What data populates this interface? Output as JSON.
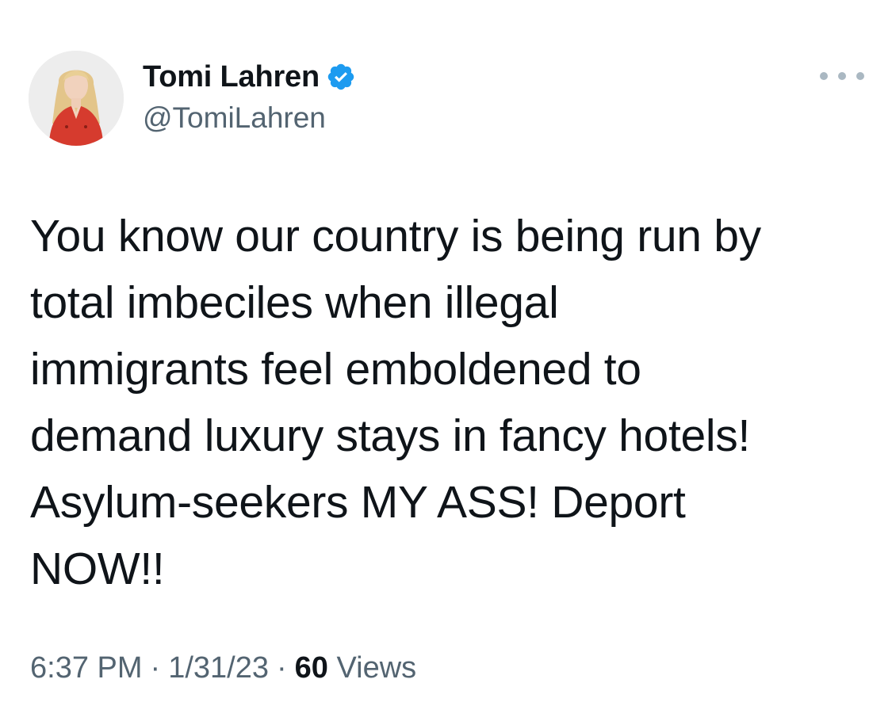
{
  "author": {
    "display_name": "Tomi Lahren",
    "handle": "@TomiLahren",
    "verified_icon": "verified-badge-icon",
    "avatar_icon": "profile-photo",
    "badge_color": "#1d9bf0"
  },
  "more_icon": "more-options-icon",
  "tweet": {
    "text": "You know our country is being run by\ntotal imbeciles when illegal\nimmigrants feel emboldened to\ndemand luxury stays in fancy hotels!\nAsylum-seekers MY ASS! Deport\nNOW!!"
  },
  "meta": {
    "time": "6:37 PM",
    "separator": "·",
    "date": "1/31/23",
    "views_count": "60",
    "views_label": "Views"
  },
  "colors": {
    "text_primary": "#0f1419",
    "text_secondary": "#536471",
    "more_dots": "#aab8c2"
  }
}
